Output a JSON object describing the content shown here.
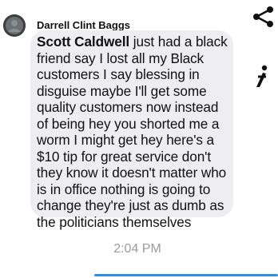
{
  "sender": {
    "name": "Darrell Clint Baggs"
  },
  "message": {
    "mention": "Scott Caldwell",
    "line1_rest": " just had a black",
    "lines": [
      "friend say I lost all my Black",
      "customers I say blessing in",
      "disguise maybe I'll get some",
      "quality customers now instead",
      "of being hey you shorted me a",
      "worm I might get hey here's a",
      "$10 tip for great service don't",
      "they know it doesn't matter who",
      "is in office nothing is going to",
      "change they're just as dumb as",
      "the politicians themselves"
    ]
  },
  "timestamp": "2:04 PM",
  "icons": {
    "share": "share-icon",
    "react": "react-icon",
    "avatar": "avatar-icon"
  },
  "colors": {
    "bubble": "#eeedf2",
    "timestamp": "#9a9aa0",
    "accent": "#2f8cf0"
  }
}
